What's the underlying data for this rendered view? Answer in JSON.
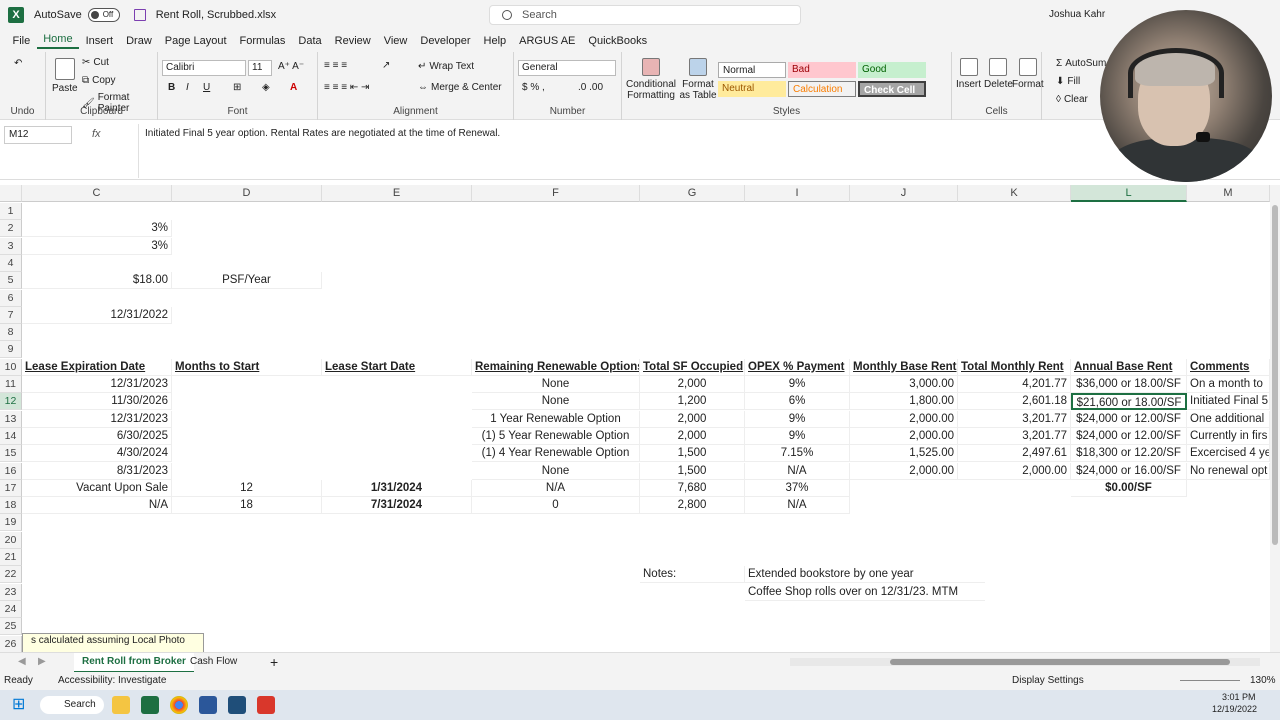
{
  "app": {
    "logo": "X",
    "autosave_label": "AutoSave",
    "autosave_state": "Off",
    "filename": "Rent Roll, Scrubbed.xlsx",
    "search_placeholder": "Search",
    "user_name": "Joshua Kahr"
  },
  "menu": [
    "File",
    "Home",
    "Insert",
    "Draw",
    "Page Layout",
    "Formulas",
    "Data",
    "Review",
    "View",
    "Developer",
    "Help",
    "ARGUS AE",
    "QuickBooks"
  ],
  "ribbon": {
    "undo_label": "Undo",
    "clipboard": {
      "label": "Clipboard",
      "paste": "Paste",
      "cut": "Cut",
      "copy": "Copy",
      "format_painter": "Format Painter"
    },
    "font": {
      "label": "Font",
      "name": "Calibri",
      "size": "11"
    },
    "alignment": {
      "label": "Alignment",
      "wrap": "Wrap Text",
      "merge": "Merge & Center"
    },
    "number": {
      "label": "Number",
      "format": "General"
    },
    "conditional": "Conditional Formatting",
    "format_table": "Format as Table",
    "styles": {
      "label": "Styles",
      "normal": "Normal",
      "bad": "Bad",
      "good": "Good",
      "neutral": "Neutral",
      "calculation": "Calculation",
      "check_cell": "Check Cell"
    },
    "cells": {
      "label": "Cells",
      "insert": "Insert",
      "delete": "Delete",
      "format": "Format"
    },
    "editing": {
      "autosum": "AutoSum",
      "fill": "Fill",
      "clear": "Clear"
    }
  },
  "formula_bar": {
    "name_box": "M12",
    "fx": "fx",
    "content": "Initiated Final 5 year option. Rental Rates are negotiated at the time of Renewal."
  },
  "columns": [
    {
      "id": "C",
      "label": "C"
    },
    {
      "id": "D",
      "label": "D"
    },
    {
      "id": "E",
      "label": "E"
    },
    {
      "id": "F",
      "label": "F"
    },
    {
      "id": "G",
      "label": "G"
    },
    {
      "id": "I",
      "label": "I"
    },
    {
      "id": "J",
      "label": "J"
    },
    {
      "id": "K",
      "label": "K"
    },
    {
      "id": "L",
      "label": "L"
    },
    {
      "id": "M",
      "label": "M"
    }
  ],
  "rows": [
    "1",
    "2",
    "3",
    "4",
    "5",
    "6",
    "7",
    "8",
    "9",
    "10",
    "11",
    "12",
    "13",
    "14",
    "15",
    "16",
    "17",
    "18",
    "19",
    "20",
    "21",
    "22",
    "23",
    "24",
    "25",
    "26"
  ],
  "cells": {
    "C2": "3%",
    "C3": "3%",
    "C5": "$18.00",
    "D5": "PSF/Year",
    "C7": "12/31/2022",
    "C10": "Lease Expiration Date",
    "D10": "Months to Start",
    "E10": "Lease Start Date",
    "F10": "Remaining Renewable Options",
    "G10": "Total SF Occupied",
    "I10": "OPEX % Payment",
    "J10": "Monthly Base Rent",
    "K10": "Total Monthly Rent",
    "L10": "Annual Base Rent",
    "M10": "Comments",
    "C11": "12/31/2023",
    "F11": "None",
    "G11": "2,000",
    "I11": "9%",
    "J11": "3,000.00",
    "K11": "4,201.77",
    "L11": "$36,000 or 18.00/SF",
    "M11": "On a month to",
    "C12": "11/30/2026",
    "F12": "None",
    "G12": "1,200",
    "I12": "6%",
    "J12": "1,800.00",
    "K12": "2,601.18",
    "L12": "$21,600 or 18.00/SF",
    "M12": "Initiated Final 5",
    "C13": "12/31/2023",
    "F13": "1 Year Renewable Option",
    "G13": "2,000",
    "I13": "9%",
    "J13": "2,000.00",
    "K13": "3,201.77",
    "L13": "$24,000 or 12.00/SF",
    "M13": "One additional",
    "C14": "6/30/2025",
    "F14": "(1) 5 Year Renewable Option",
    "G14": "2,000",
    "I14": "9%",
    "J14": "2,000.00",
    "K14": "3,201.77",
    "L14": "$24,000 or 12.00/SF",
    "M14": "Currently in firs",
    "C15": "4/30/2024",
    "F15": "(1) 4 Year Renewable Option",
    "G15": "1,500",
    "I15": "7.15%",
    "J15": "1,525.00",
    "K15": "2,497.61",
    "L15": "$18,300 or 12.20/SF",
    "M15": "Excercised 4 ye",
    "C16": "8/31/2023",
    "F16": "None",
    "G16": "1,500",
    "I16": "N/A",
    "J16": "2,000.00",
    "K16": "2,000.00",
    "L16": "$24,000 or 16.00/SF",
    "M16": "No renewal opt",
    "C17": "Vacant Upon Sale",
    "D17": "12",
    "E17": "1/31/2024",
    "F17": "N/A",
    "G17": "7,680",
    "I17": "37%",
    "L17": "$0.00/SF",
    "C18": "N/A",
    "D18": "18",
    "E18": "7/31/2024",
    "F18": "0",
    "G18": "2,800",
    "I18": "N/A",
    "G22": "Notes:",
    "I22": "Extended bookstore by one year",
    "I23": "Coffee Shop rolls over on 12/31/23. MTM"
  },
  "comment_box": "s calculated assuming Local  Photo",
  "sheets": [
    "Rent Roll from Broker",
    "Cash Flow"
  ],
  "status": {
    "ready": "Ready",
    "accessibility": "Accessibility: Investigate",
    "display_settings": "Display Settings",
    "zoom": "130%"
  },
  "taskbar": {
    "search": "Search",
    "time": "3:01 PM",
    "date": "12/19/2022"
  }
}
